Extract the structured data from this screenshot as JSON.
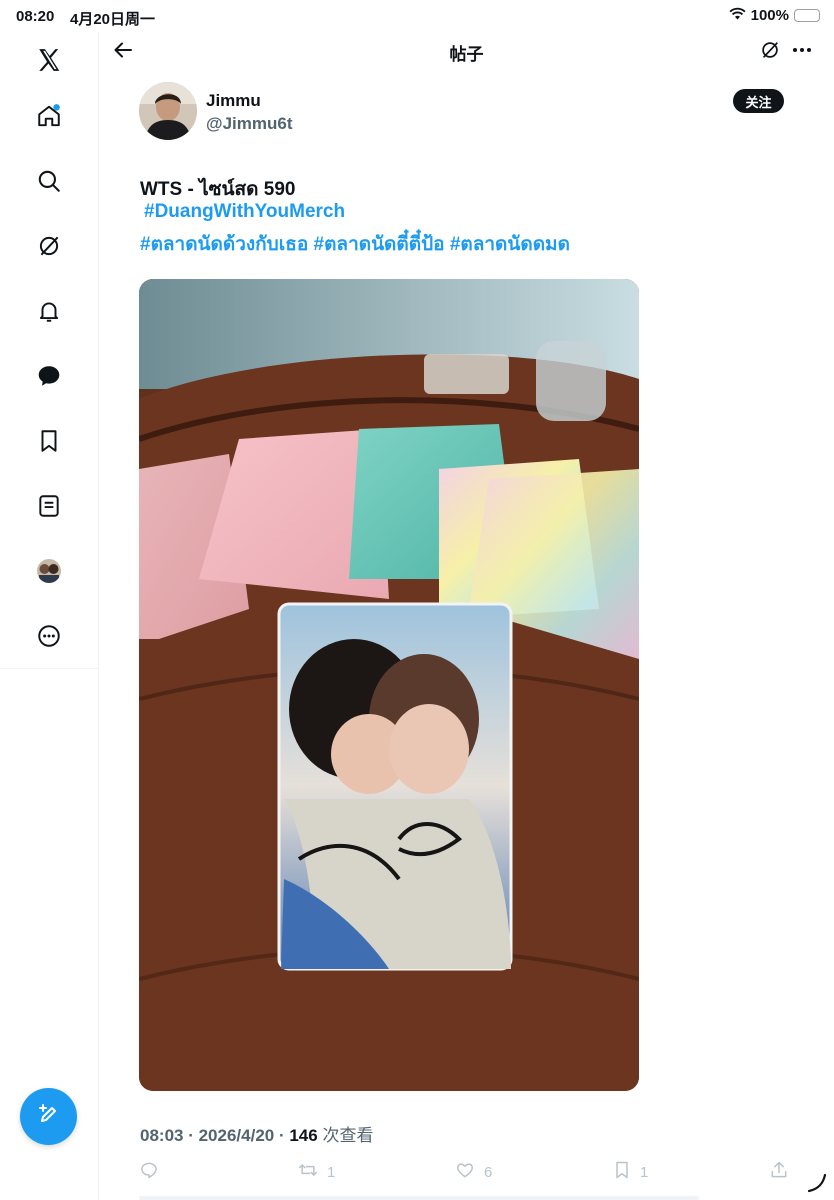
{
  "status_bar": {
    "time": "08:20",
    "date": "4月20日周一",
    "battery": "100%"
  },
  "sidebar": {
    "items": [
      {
        "name": "x-logo-icon"
      },
      {
        "name": "home-icon"
      },
      {
        "name": "search-icon"
      },
      {
        "name": "grok-icon"
      },
      {
        "name": "notifications-icon"
      },
      {
        "name": "messages-icon"
      },
      {
        "name": "bookmarks-icon"
      },
      {
        "name": "lists-icon"
      },
      {
        "name": "profile-avatar-icon"
      },
      {
        "name": "more-icon"
      }
    ],
    "compose_icon": "compose-icon"
  },
  "header": {
    "title": "帖子"
  },
  "post": {
    "author_name": "Jimmu",
    "author_handle": "@Jimmu6t",
    "follow_label": "关注",
    "line1": "WTS - ไซน์สด 590",
    "line2": "#DuangWithYouMerch",
    "line3": "#ตลาดนัดด้วงกับเธอ #ตลาดนัดตี๋ตี๋ป้อ #ตลาดนัดดมด",
    "time": "08:03",
    "sep": " · ",
    "date": "2026/4/20",
    "views": "146",
    "views_label": " 次查看",
    "actions": {
      "reply_count": "",
      "retweet_count": "1",
      "like_count": "6",
      "bookmark_count": "1"
    }
  },
  "colors": {
    "accent": "#1d9bf0",
    "text": "#0f1419",
    "muted": "#536471"
  }
}
